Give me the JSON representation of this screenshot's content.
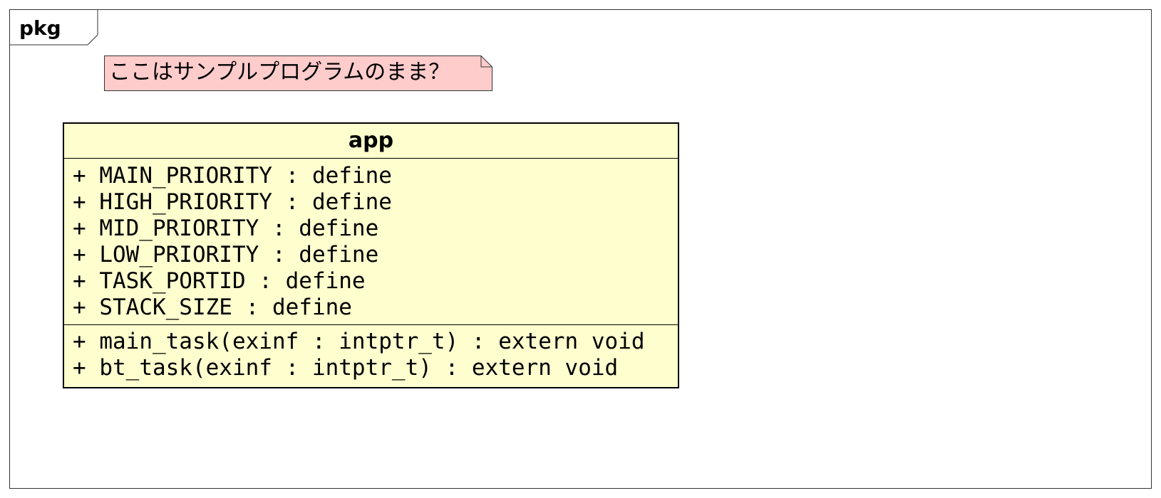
{
  "package": {
    "name": "pkg"
  },
  "note": {
    "text": "ここはサンプルプログラムのまま？",
    "fill_color": "#ffcccc"
  },
  "class": {
    "name": "app",
    "fill_color": "#fefece",
    "attributes": [
      "+ MAIN_PRIORITY : define",
      "+ HIGH_PRIORITY : define",
      "+ MID_PRIORITY : define",
      "+ LOW_PRIORITY : define",
      "+ TASK_PORTID : define",
      "+ STACK_SIZE : define"
    ],
    "operations": [
      "+ main_task(exinf : intptr_t) : extern void",
      "+ bt_task(exinf : intptr_t) : extern void"
    ]
  }
}
